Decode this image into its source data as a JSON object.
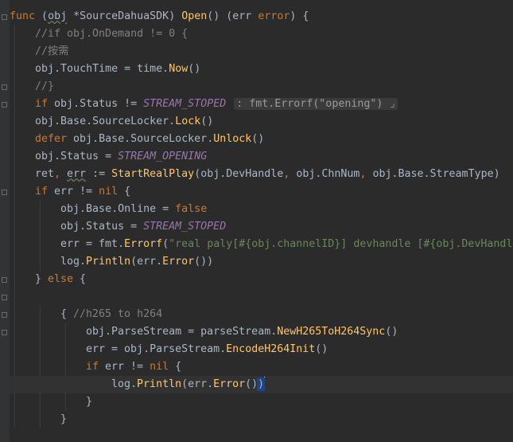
{
  "editor": {
    "lines": [
      {
        "indent": 0,
        "tokens": [
          {
            "t": "func",
            "c": "kw"
          },
          {
            "t": " ",
            "c": "p"
          },
          {
            "t": "(",
            "c": "p"
          },
          {
            "t": "obj",
            "c": "param"
          },
          {
            "t": " *SourceDahuaSDK",
            "c": "ty"
          },
          {
            "t": ") ",
            "c": "p"
          },
          {
            "t": "Open",
            "c": "fnname"
          },
          {
            "t": "() (",
            "c": "p"
          },
          {
            "t": "err",
            "c": "obj"
          },
          {
            "t": " ",
            "c": "p"
          },
          {
            "t": "error",
            "c": "kw"
          },
          {
            "t": ") {",
            "c": "p"
          }
        ]
      },
      {
        "indent": 1,
        "tokens": [
          {
            "t": "//if obj.OnDemand != 0 {",
            "c": "cmt"
          }
        ]
      },
      {
        "indent": 1,
        "tokens": [
          {
            "t": "//按需",
            "c": "cmt"
          }
        ]
      },
      {
        "indent": 1,
        "tokens": [
          {
            "t": "obj",
            "c": "obj"
          },
          {
            "t": ".",
            "c": "p"
          },
          {
            "t": "TouchTime",
            "c": "field"
          },
          {
            "t": " = ",
            "c": "op"
          },
          {
            "t": "time",
            "c": "pkg"
          },
          {
            "t": ".",
            "c": "p"
          },
          {
            "t": "Now",
            "c": "call"
          },
          {
            "t": "()",
            "c": "p"
          }
        ]
      },
      {
        "indent": 1,
        "tokens": [
          {
            "t": "//}",
            "c": "cmt"
          }
        ]
      },
      {
        "indent": 1,
        "tokens": [
          {
            "t": "if",
            "c": "kw"
          },
          {
            "t": " obj",
            "c": "obj"
          },
          {
            "t": ".",
            "c": "p"
          },
          {
            "t": "Status",
            "c": "field"
          },
          {
            "t": " != ",
            "c": "op"
          },
          {
            "t": "STREAM_STOPED",
            "c": "const"
          },
          {
            "t": " ",
            "c": "p"
          },
          {
            "t": ": fmt.Errorf(\"opening\") ⌟",
            "c": "hint"
          }
        ]
      },
      {
        "indent": 1,
        "tokens": [
          {
            "t": "obj",
            "c": "obj"
          },
          {
            "t": ".",
            "c": "p"
          },
          {
            "t": "Base",
            "c": "field"
          },
          {
            "t": ".",
            "c": "p"
          },
          {
            "t": "SourceLocker",
            "c": "field"
          },
          {
            "t": ".",
            "c": "p"
          },
          {
            "t": "Lock",
            "c": "call"
          },
          {
            "t": "()",
            "c": "p"
          }
        ]
      },
      {
        "indent": 1,
        "tokens": [
          {
            "t": "defer",
            "c": "kw"
          },
          {
            "t": " obj",
            "c": "obj"
          },
          {
            "t": ".",
            "c": "p"
          },
          {
            "t": "Base",
            "c": "field"
          },
          {
            "t": ".",
            "c": "p"
          },
          {
            "t": "SourceLocker",
            "c": "field"
          },
          {
            "t": ".",
            "c": "p"
          },
          {
            "t": "Unlock",
            "c": "call"
          },
          {
            "t": "()",
            "c": "p"
          }
        ]
      },
      {
        "indent": 1,
        "tokens": [
          {
            "t": "obj",
            "c": "obj"
          },
          {
            "t": ".",
            "c": "p"
          },
          {
            "t": "Status",
            "c": "field"
          },
          {
            "t": " = ",
            "c": "op"
          },
          {
            "t": "STREAM_OPENING",
            "c": "const"
          }
        ]
      },
      {
        "indent": 1,
        "tokens": [
          {
            "t": "ret",
            "c": "obj"
          },
          {
            "t": ", ",
            "c": "kw"
          },
          {
            "t": "err",
            "c": "param"
          },
          {
            "t": " := ",
            "c": "op"
          },
          {
            "t": "StartRealPlay",
            "c": "call"
          },
          {
            "t": "(",
            "c": "p"
          },
          {
            "t": "obj",
            "c": "obj"
          },
          {
            "t": ".",
            "c": "p"
          },
          {
            "t": "DevHandle",
            "c": "field"
          },
          {
            "t": ", ",
            "c": "kw"
          },
          {
            "t": "obj",
            "c": "obj"
          },
          {
            "t": ".",
            "c": "p"
          },
          {
            "t": "ChnNum",
            "c": "field"
          },
          {
            "t": ", ",
            "c": "kw"
          },
          {
            "t": "obj",
            "c": "obj"
          },
          {
            "t": ".",
            "c": "p"
          },
          {
            "t": "Base",
            "c": "field"
          },
          {
            "t": ".",
            "c": "p"
          },
          {
            "t": "StreamType",
            "c": "field"
          },
          {
            "t": ")",
            "c": "p"
          }
        ]
      },
      {
        "indent": 1,
        "tokens": [
          {
            "t": "if",
            "c": "kw"
          },
          {
            "t": " err != ",
            "c": "op"
          },
          {
            "t": "nil",
            "c": "kw"
          },
          {
            "t": " {",
            "c": "p"
          }
        ]
      },
      {
        "indent": 2,
        "tokens": [
          {
            "t": "obj",
            "c": "obj"
          },
          {
            "t": ".",
            "c": "p"
          },
          {
            "t": "Base",
            "c": "field"
          },
          {
            "t": ".",
            "c": "p"
          },
          {
            "t": "Online",
            "c": "field"
          },
          {
            "t": " = ",
            "c": "op"
          },
          {
            "t": "false",
            "c": "kw"
          }
        ]
      },
      {
        "indent": 2,
        "tokens": [
          {
            "t": "obj",
            "c": "obj"
          },
          {
            "t": ".",
            "c": "p"
          },
          {
            "t": "Status",
            "c": "field"
          },
          {
            "t": " = ",
            "c": "op"
          },
          {
            "t": "STREAM_STOPED",
            "c": "const"
          }
        ]
      },
      {
        "indent": 2,
        "tokens": [
          {
            "t": "err = ",
            "c": "op"
          },
          {
            "t": "fmt",
            "c": "pkg"
          },
          {
            "t": ".",
            "c": "p"
          },
          {
            "t": "Errorf",
            "c": "call"
          },
          {
            "t": "(",
            "c": "p"
          },
          {
            "t": "\"real paly[#{obj.channelID}] devhandle [#{obj.DevHandl",
            "c": "str"
          }
        ]
      },
      {
        "indent": 2,
        "tokens": [
          {
            "t": "log",
            "c": "pkg"
          },
          {
            "t": ".",
            "c": "p"
          },
          {
            "t": "Println",
            "c": "call"
          },
          {
            "t": "(err.",
            "c": "p"
          },
          {
            "t": "Error",
            "c": "call"
          },
          {
            "t": "())",
            "c": "p"
          }
        ]
      },
      {
        "indent": 1,
        "tokens": [
          {
            "t": "} ",
            "c": "p"
          },
          {
            "t": "else",
            "c": "kw"
          },
          {
            "t": " {",
            "c": "p"
          }
        ]
      },
      {
        "indent": 0,
        "tokens": []
      },
      {
        "indent": 2,
        "tokens": [
          {
            "t": "{ ",
            "c": "p"
          },
          {
            "t": "//h265 to h264",
            "c": "cmt"
          }
        ]
      },
      {
        "indent": 3,
        "tokens": [
          {
            "t": "obj",
            "c": "obj"
          },
          {
            "t": ".",
            "c": "p"
          },
          {
            "t": "ParseStream",
            "c": "field"
          },
          {
            "t": " = ",
            "c": "op"
          },
          {
            "t": "parseStream",
            "c": "pkg"
          },
          {
            "t": ".",
            "c": "p"
          },
          {
            "t": "NewH265ToH264Sync",
            "c": "call"
          },
          {
            "t": "()",
            "c": "p"
          }
        ]
      },
      {
        "indent": 3,
        "tokens": [
          {
            "t": "err = ",
            "c": "op"
          },
          {
            "t": "obj",
            "c": "obj"
          },
          {
            "t": ".",
            "c": "p"
          },
          {
            "t": "ParseStream",
            "c": "field"
          },
          {
            "t": ".",
            "c": "p"
          },
          {
            "t": "EncodeH264Init",
            "c": "call"
          },
          {
            "t": "()",
            "c": "p"
          }
        ]
      },
      {
        "indent": 3,
        "tokens": [
          {
            "t": "if",
            "c": "kw"
          },
          {
            "t": " err != ",
            "c": "op"
          },
          {
            "t": "nil",
            "c": "kw"
          },
          {
            "t": " {",
            "c": "p"
          }
        ]
      },
      {
        "indent": 4,
        "current": true,
        "tokens": [
          {
            "t": "log",
            "c": "pkg"
          },
          {
            "t": ".",
            "c": "p"
          },
          {
            "t": "Println",
            "c": "call"
          },
          {
            "t": "(err.",
            "c": "p"
          },
          {
            "t": "Error",
            "c": "call"
          },
          {
            "t": "()",
            "c": "p"
          },
          {
            "t": ")",
            "c": "hl"
          }
        ]
      },
      {
        "indent": 3,
        "tokens": [
          {
            "t": "}",
            "c": "p"
          }
        ]
      },
      {
        "indent": 2,
        "tokens": [
          {
            "t": "}",
            "c": "p"
          }
        ]
      },
      {
        "indent": 0,
        "tokens": []
      }
    ]
  },
  "colors": {
    "background": "#2b2b2b",
    "keyword": "#cc7832",
    "function": "#ffc66d",
    "constant": "#9876aa",
    "comment": "#808080",
    "string": "#6a8759",
    "text": "#a9b7c6"
  }
}
